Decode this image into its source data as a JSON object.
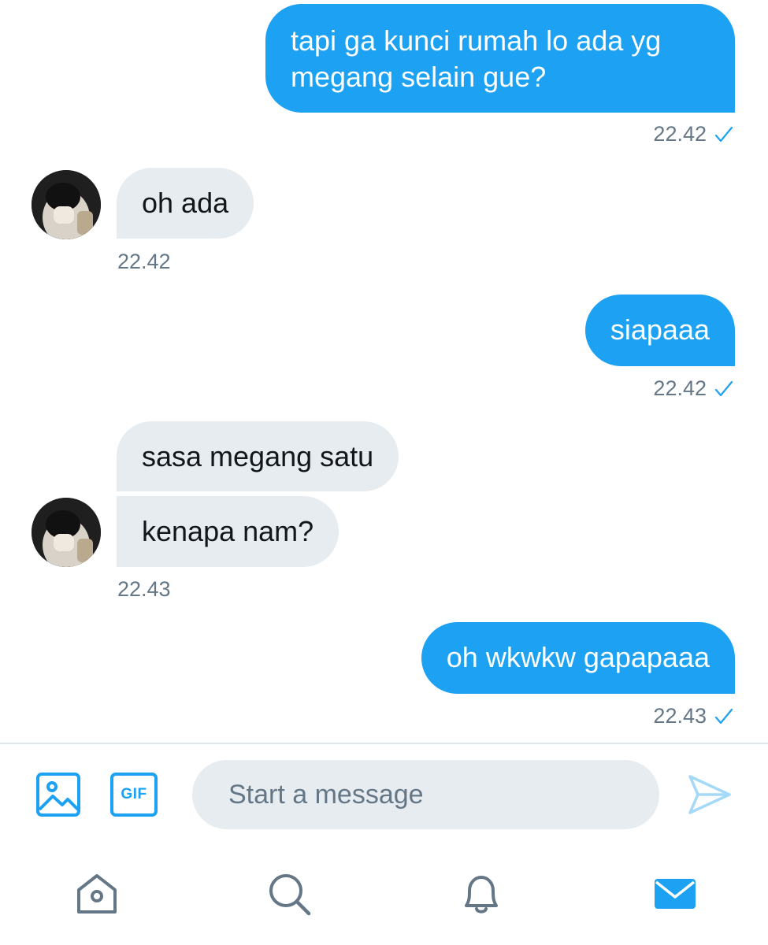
{
  "conversation": {
    "messages": [
      {
        "direction": "sent",
        "lines": [
          "tapi ga kunci rumah lo ada yg",
          "megang selain gue?"
        ]
      },
      {
        "direction": "received",
        "text": "oh ada"
      },
      {
        "direction": "sent",
        "text": "siapaaa"
      },
      {
        "direction": "received",
        "text": "sasa megang satu"
      },
      {
        "direction": "received",
        "text": "kenapa nam?"
      },
      {
        "direction": "sent",
        "text": "oh wkwkw gapapaaa"
      }
    ],
    "timestamps": [
      "22.42",
      "22.42",
      "22.42",
      "22.43",
      "22.43"
    ]
  },
  "composer": {
    "placeholder": "Start a message",
    "gif_label": "GIF"
  },
  "icons": {
    "media": "image-icon",
    "gif": "gif-icon",
    "send": "send-icon",
    "read": "checkmark-icon",
    "tabs": [
      "home-icon",
      "search-icon",
      "notifications-icon",
      "messages-icon"
    ]
  },
  "colors": {
    "accent": "#1da1f2",
    "bubble_received": "#e6ecf0",
    "timestamp": "#657786",
    "send_disabled": "#a5d9f9"
  },
  "tab_bar": {
    "active": "messages"
  }
}
